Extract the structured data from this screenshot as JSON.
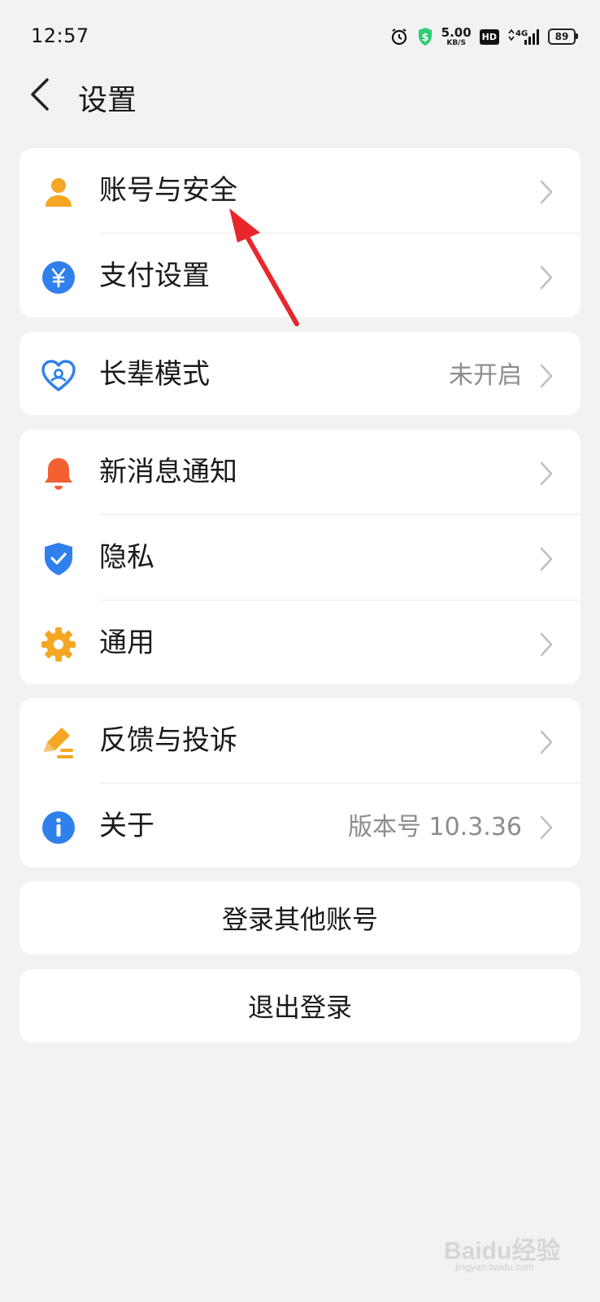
{
  "status_bar": {
    "time": "12:57",
    "net_speed_value": "5.00",
    "net_speed_unit": "KB/S",
    "hd_label": "HD",
    "signal_label": "4G",
    "battery": "89",
    "icons": [
      "alarm-icon",
      "shield-dollar-icon",
      "hd-icon",
      "signal-4g-icon",
      "battery-icon"
    ]
  },
  "header": {
    "title": "设置",
    "back_icon": "chevron-left-icon"
  },
  "groups": [
    {
      "items": [
        {
          "label": "账号与安全",
          "icon": "user-icon",
          "color": "#f5a623"
        },
        {
          "label": "支付设置",
          "icon": "yuan-icon",
          "color": "#2f80ed"
        }
      ]
    },
    {
      "items": [
        {
          "label": "长辈模式",
          "value": "未开启",
          "icon": "heart-icon",
          "color": "#2f80ed"
        }
      ]
    },
    {
      "items": [
        {
          "label": "新消息通知",
          "icon": "bell-icon",
          "color": "#f56032"
        },
        {
          "label": "隐私",
          "icon": "shield-check-icon",
          "color": "#2f80ed"
        },
        {
          "label": "通用",
          "icon": "gear-icon",
          "color": "#f5a623"
        }
      ]
    },
    {
      "items": [
        {
          "label": "反馈与投诉",
          "icon": "pencil-icon",
          "color": "#f5a623"
        },
        {
          "label": "关于",
          "value": "版本号 10.3.36",
          "icon": "info-icon",
          "color": "#2f80ed"
        }
      ]
    }
  ],
  "actions": {
    "switch_account": "登录其他账号",
    "logout": "退出登录"
  },
  "annotation": {
    "color": "#e8262b"
  },
  "watermark": {
    "text": "Baidu经验",
    "sub": "jingyan.baidu.com"
  }
}
